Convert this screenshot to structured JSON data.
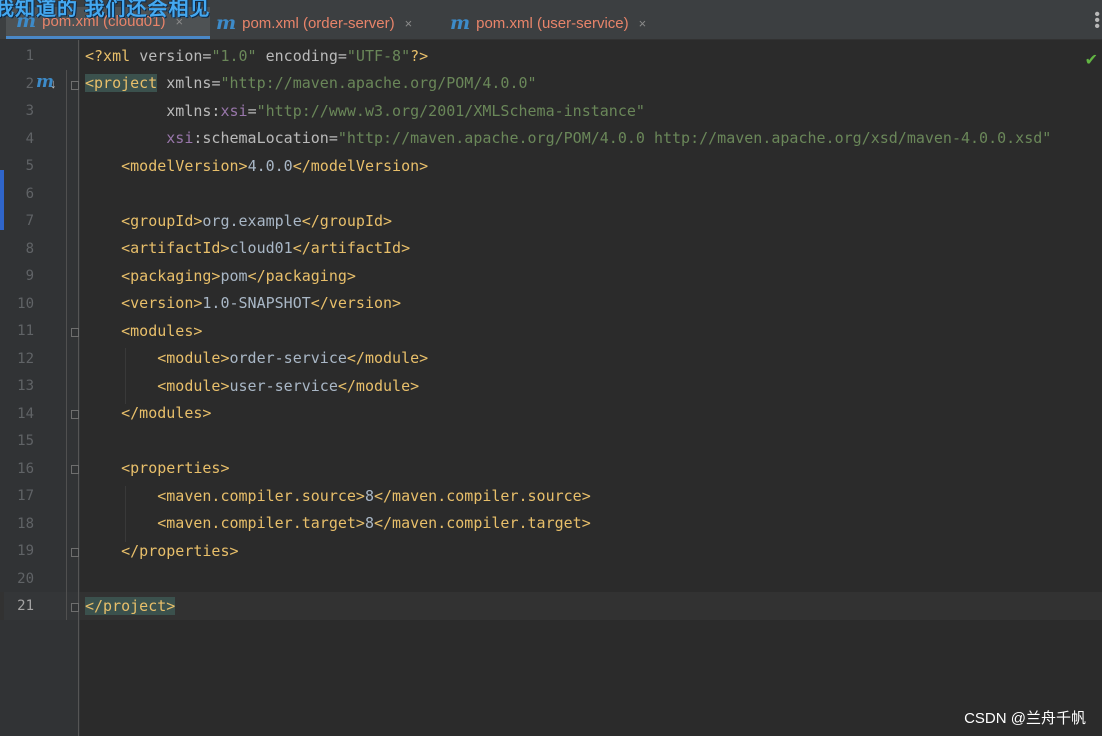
{
  "overlay": {
    "text": "我知道的 我们还会相见"
  },
  "tabs": [
    {
      "label": "pom.xml (cloud01)",
      "icon": "maven-icon",
      "close": "×",
      "active": true
    },
    {
      "label": "pom.xml (order-server)",
      "icon": "maven-icon",
      "close": "×",
      "active": false
    },
    {
      "label": "pom.xml (user-service)",
      "icon": "maven-icon",
      "close": "×",
      "active": false
    }
  ],
  "editor": {
    "line_numbers": [
      "1",
      "2",
      "3",
      "4",
      "5",
      "6",
      "7",
      "8",
      "9",
      "10",
      "11",
      "12",
      "13",
      "14",
      "15",
      "16",
      "17",
      "18",
      "19",
      "20",
      "21"
    ],
    "current_line": 21,
    "gutter_icon": "m",
    "status_icon": "check-icon",
    "lines": {
      "l1": {
        "open": "<?xml ",
        "a1": "version",
        "eq1": "=",
        "v1": "\"1.0\"",
        "sp": " ",
        "a2": "encoding",
        "eq2": "=",
        "v2": "\"UTF-8\"",
        "close": "?>"
      },
      "l2": {
        "tag": "<project",
        "sp": " ",
        "attr": "xmlns",
        "eq": "=",
        "val": "\"http://maven.apache.org/POM/4.0.0\""
      },
      "l3": {
        "indent": "         ",
        "attr": "xmlns:",
        "ns": "xsi",
        "eq": "=",
        "val": "\"http://www.w3.org/2001/XMLSchema-instance\""
      },
      "l4": {
        "indent": "         ",
        "ns": "xsi",
        "attr": ":schemaLocation",
        "eq": "=",
        "val": "\"http://maven.apache.org/POM/4.0.0 http://maven.apache.org/xsd/maven-4.0.0.xsd\""
      },
      "l5": {
        "indent": "    ",
        "open": "<modelVersion>",
        "text": "4.0.0",
        "close": "</modelVersion>"
      },
      "l7": {
        "indent": "    ",
        "open": "<groupId>",
        "text": "org.example",
        "close": "</groupId>"
      },
      "l8": {
        "indent": "    ",
        "open": "<artifactId>",
        "text": "cloud01",
        "close": "</artifactId>"
      },
      "l9": {
        "indent": "    ",
        "open": "<packaging>",
        "text": "pom",
        "close": "</packaging>"
      },
      "l10": {
        "indent": "    ",
        "open": "<version>",
        "text": "1.0-SNAPSHOT",
        "close": "</version>"
      },
      "l11": {
        "indent": "    ",
        "tag": "<modules>"
      },
      "l12": {
        "indent": "        ",
        "open": "<module>",
        "text": "order-service",
        "close": "</module>"
      },
      "l13": {
        "indent": "        ",
        "open": "<module>",
        "text": "user-service",
        "close": "</module>"
      },
      "l14": {
        "indent": "    ",
        "tag": "</modules>"
      },
      "l16": {
        "indent": "    ",
        "tag": "<properties>"
      },
      "l17": {
        "indent": "        ",
        "open": "<maven.compiler.source>",
        "text": "8",
        "close": "</maven.compiler.source>"
      },
      "l18": {
        "indent": "        ",
        "open": "<maven.compiler.target>",
        "text": "8",
        "close": "</maven.compiler.target>"
      },
      "l19": {
        "indent": "    ",
        "tag": "</properties>"
      },
      "l21": {
        "tag": "</project>"
      }
    }
  },
  "watermark": {
    "text": "CSDN @兰舟千帆"
  }
}
